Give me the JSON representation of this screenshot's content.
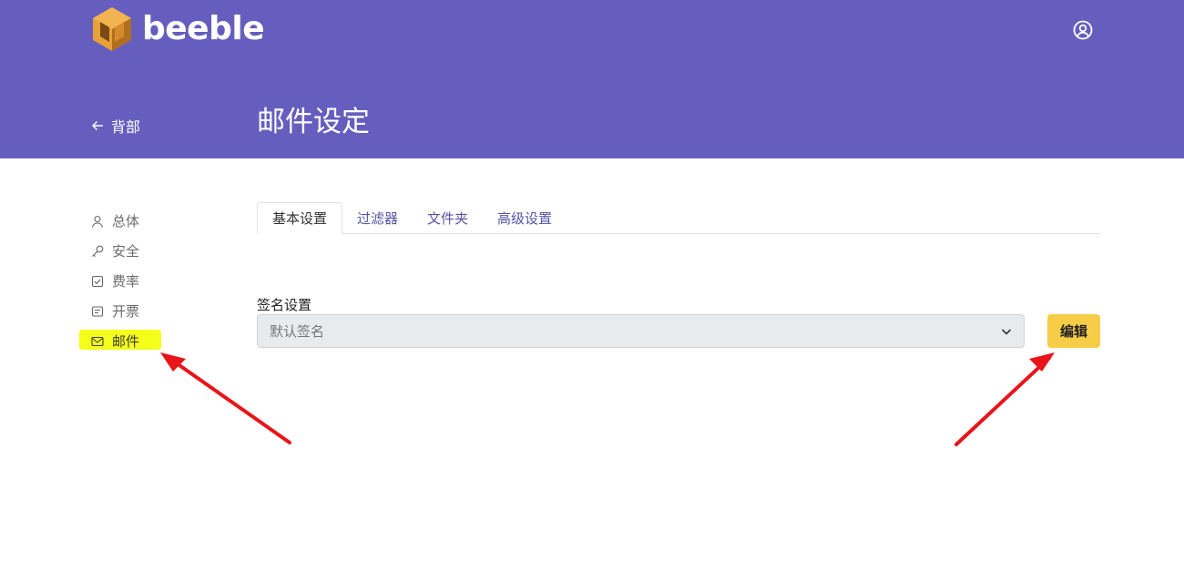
{
  "brand": {
    "name": "beeble"
  },
  "header": {
    "back_label": "背部",
    "page_title": "邮件设定"
  },
  "sidebar": {
    "items": [
      {
        "label": "总体",
        "icon": "user-icon"
      },
      {
        "label": "安全",
        "icon": "key-icon"
      },
      {
        "label": "费率",
        "icon": "checkbox-icon"
      },
      {
        "label": "开票",
        "icon": "receipt-icon"
      },
      {
        "label": "邮件",
        "icon": "mail-icon",
        "active": true
      }
    ]
  },
  "tabs": [
    {
      "label": "基本设置",
      "active": true
    },
    {
      "label": "过滤器"
    },
    {
      "label": "文件夹"
    },
    {
      "label": "高级设置"
    }
  ],
  "signature": {
    "label": "签名设置",
    "selected": "默认签名",
    "edit_label": "编辑"
  },
  "colors": {
    "header_bg": "#665ebe",
    "edit_button": "#f7cd47",
    "highlight": "#f4ff1a",
    "annotation_arrow": "#e8141a"
  }
}
